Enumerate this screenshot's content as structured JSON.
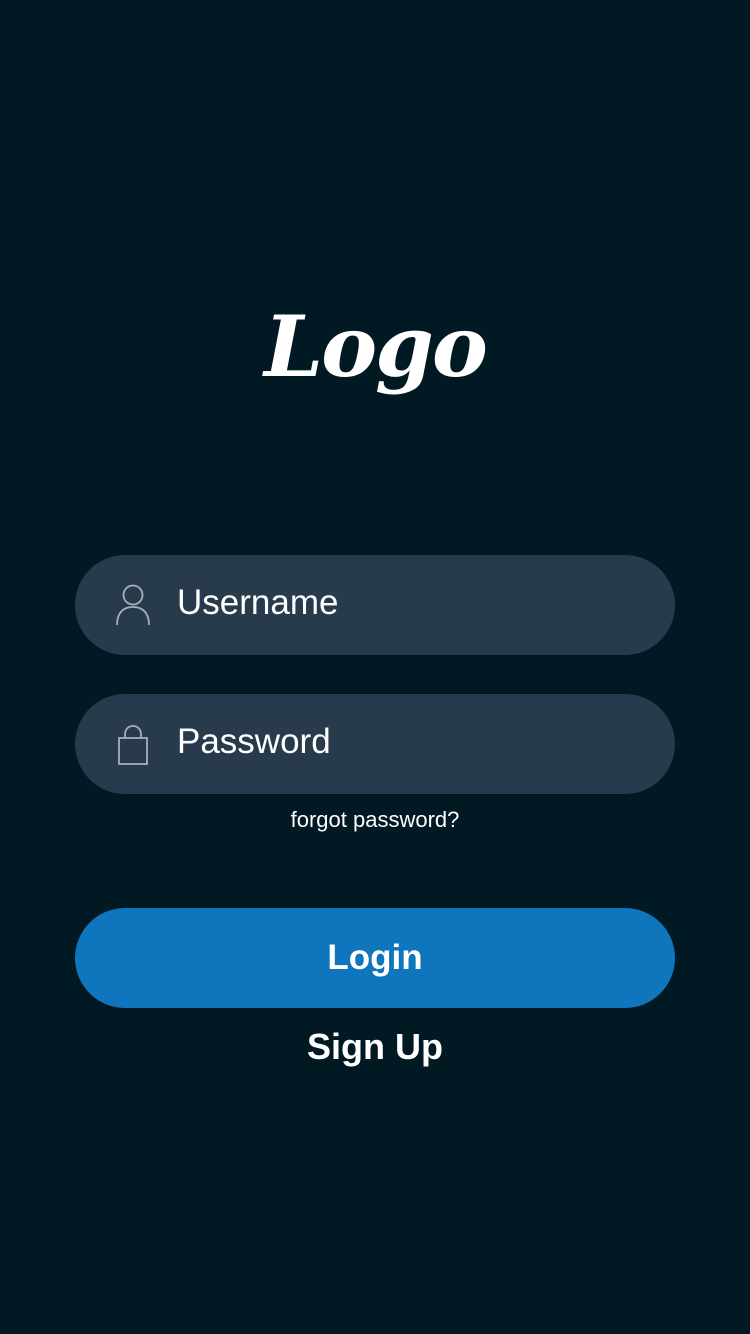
{
  "logo": {
    "text": "Logo"
  },
  "login_form": {
    "username": {
      "placeholder": "Username",
      "icon": "user-icon"
    },
    "password": {
      "placeholder": "Password",
      "icon": "lock-icon"
    },
    "forgot_password_label": "forgot password?",
    "login_label": "Login",
    "signup_label": "Sign Up"
  },
  "colors": {
    "background": "#011923",
    "field_background": "#283b4c",
    "accent": "#0f76bd",
    "text": "#ffffff",
    "icon_stroke": "#a8b0b8"
  }
}
